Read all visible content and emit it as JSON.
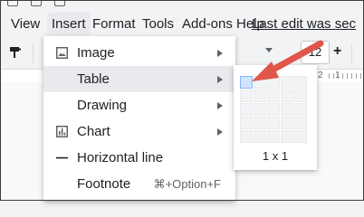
{
  "menubar": {
    "items": [
      "View",
      "Insert",
      "Format",
      "Tools",
      "Add-ons",
      "Help"
    ],
    "last_edit": "Last edit was sec"
  },
  "toolbar": {
    "font_size": "12",
    "plus": "+"
  },
  "ruler": {
    "numbers": [
      "2",
      "1"
    ]
  },
  "insert_menu": {
    "items": [
      {
        "label": "Image",
        "icon": "image-icon",
        "has_submenu": true
      },
      {
        "label": "Table",
        "icon": "",
        "has_submenu": true,
        "highlighted": true
      },
      {
        "label": "Drawing",
        "icon": "",
        "has_submenu": true
      },
      {
        "label": "Chart",
        "icon": "chart-icon",
        "has_submenu": true
      },
      {
        "label": "Horizontal line",
        "icon": "horizontal-line-icon",
        "has_submenu": false
      },
      {
        "label": "Footnote",
        "icon": "",
        "has_submenu": false,
        "shortcut": "⌘+Option+F"
      }
    ]
  },
  "table_submenu": {
    "rows": 5,
    "cols": 5,
    "selected_rows": 1,
    "selected_cols": 1,
    "size_label": "1 x 1"
  },
  "colors": {
    "accent_red": "#e0564a",
    "grid_selected": "#d2e3fc",
    "menu_highlight": "#e8eaed"
  }
}
